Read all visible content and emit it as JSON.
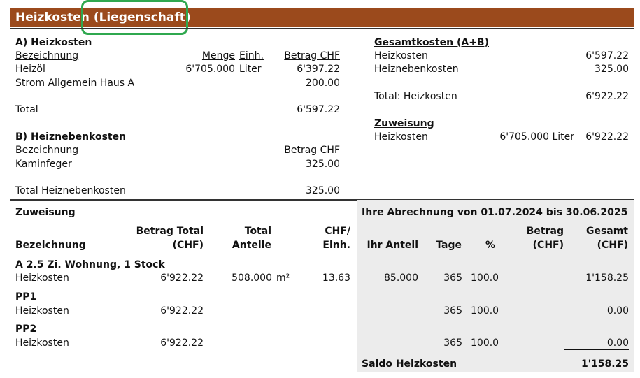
{
  "header": {
    "title_main": "Heizkosten",
    "title_sub": "(Liegenschaft)",
    "color": "#9b4a1c",
    "highlight_color": "#2fa84f"
  },
  "heizkosten": {
    "title": "A) Heizkosten",
    "cols": {
      "bezeichnung": "Bezeichnung",
      "menge": "Menge",
      "einh": "Einh.",
      "betrag": "Betrag CHF"
    },
    "rows": [
      {
        "bezeichnung": "Heizöl",
        "menge": "6'705.000",
        "einh": "Liter",
        "betrag": "6'397.22"
      },
      {
        "bezeichnung": "Strom Allgemein Haus A",
        "menge": "",
        "einh": "",
        "betrag": "200.00"
      }
    ],
    "total_label": "Total",
    "total_value": "6'597.22"
  },
  "heiznebenkosten": {
    "title": "B) Heiznebenkosten",
    "cols": {
      "bezeichnung": "Bezeichnung",
      "betrag": "Betrag CHF"
    },
    "rows": [
      {
        "bezeichnung": "Kaminfeger",
        "betrag": "325.00"
      }
    ],
    "total_label": "Total Heiznebenkosten",
    "total_value": "325.00"
  },
  "gesamtkosten": {
    "title": "Gesamtkosten (A+B)",
    "rows": [
      {
        "label": "Heizkosten",
        "value": "6'597.22"
      },
      {
        "label": "Heiznebenkosten",
        "value": "325.00"
      }
    ],
    "total_label": "Total: Heizkosten",
    "total_value": "6'922.22"
  },
  "zuweisung_top": {
    "title": "Zuweisung",
    "label": "Heizkosten",
    "menge": "6'705.000 Liter",
    "value": "6'922.22"
  },
  "zuweisung": {
    "title": "Zuweisung",
    "col_bezeichnung": "Bezeichnung",
    "col_betrag_total_1": "Betrag Total",
    "col_betrag_total_2": "(CHF)",
    "col_total_anteile_1": "Total",
    "col_total_anteile_2": "Anteile",
    "col_chf_einh_1": "CHF/",
    "col_chf_einh_2": "Einh."
  },
  "abrechnung": {
    "title": "Ihre Abrechnung von 01.07.2024 bis 30.06.2025",
    "col_ihr_anteil": "Ihr Anteil",
    "col_tage": "Tage",
    "col_pct": "%",
    "col_betrag_1": "Betrag",
    "col_betrag_2": "(CHF)",
    "col_gesamt_1": "Gesamt",
    "col_gesamt_2": "(CHF)",
    "saldo_label": "Saldo Heizkosten",
    "saldo_value": "1'158.25"
  },
  "units": [
    {
      "name": "A 2.5 Zi. Wohnung, 1 Stock",
      "bezeichnung": "Heizkosten",
      "betrag_total": "6'922.22",
      "total_anteile": "508.000",
      "einheit": "m²",
      "chf_einh": "13.63",
      "ihr_anteil": "85.000",
      "tage": "365",
      "pct": "100.0",
      "betrag": "",
      "gesamt": "1'158.25"
    },
    {
      "name": "PP1",
      "bezeichnung": "Heizkosten",
      "betrag_total": "6'922.22",
      "total_anteile": "",
      "einheit": "",
      "chf_einh": "",
      "ihr_anteil": "",
      "tage": "365",
      "pct": "100.0",
      "betrag": "",
      "gesamt": "0.00"
    },
    {
      "name": "PP2",
      "bezeichnung": "Heizkosten",
      "betrag_total": "6'922.22",
      "total_anteile": "",
      "einheit": "",
      "chf_einh": "",
      "ihr_anteil": "",
      "tage": "365",
      "pct": "100.0",
      "betrag": "",
      "gesamt": "0.00"
    }
  ]
}
